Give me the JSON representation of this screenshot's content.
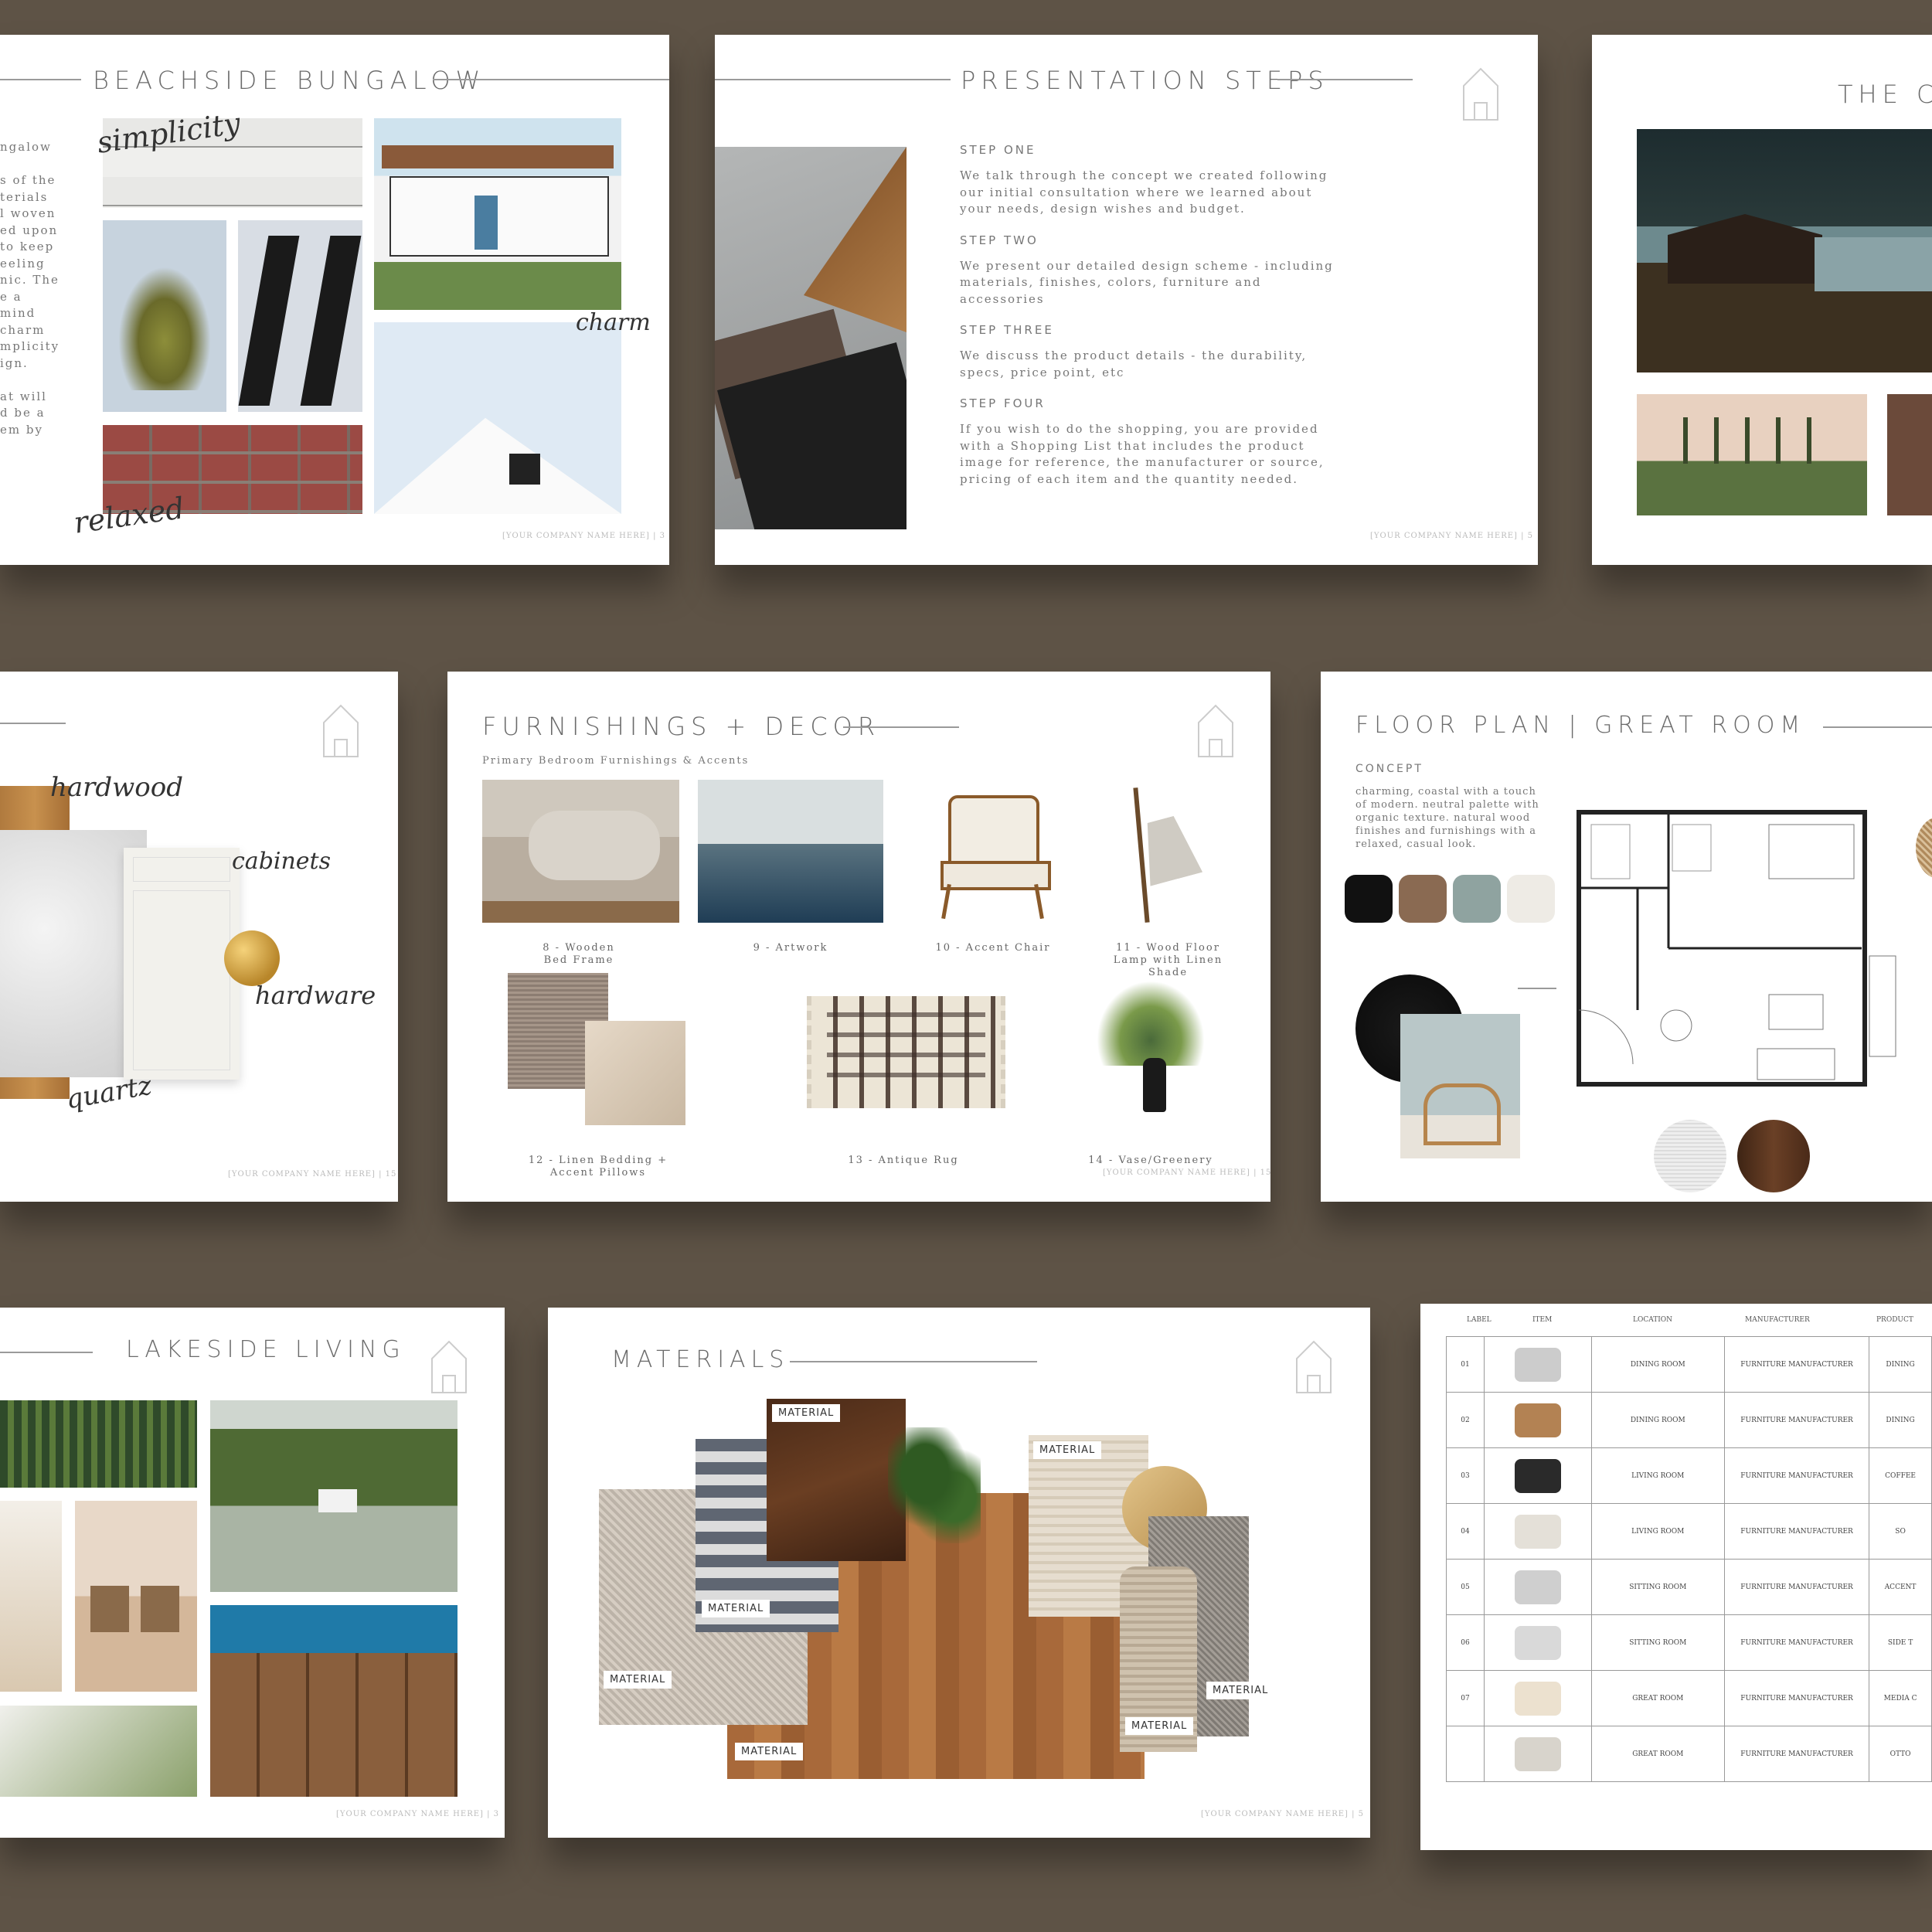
{
  "slides": {
    "beachside": {
      "title": "BEACHSIDE BUNGALOW",
      "body": [
        "ngalow",
        "",
        "s of the",
        "terials",
        "l woven",
        "ed upon",
        "to keep",
        "eeling",
        "nic. The",
        "e a",
        "mind",
        "charm",
        "mplicity",
        "ign.",
        "",
        "at will",
        "d be a",
        "em by"
      ],
      "words": [
        "simplicity",
        "charm",
        "relaxed"
      ],
      "footer": "[YOUR COMPANY NAME HERE] | 3"
    },
    "steps": {
      "title": "PRESENTATION STEPS",
      "items": [
        {
          "head": "STEP ONE",
          "text": "We talk through the concept we created following our initial consultation where we learned about your needs, design wishes and budget."
        },
        {
          "head": "STEP TWO",
          "text": "We present our detailed design scheme - including materials, finishes, colors, furniture and accessories"
        },
        {
          "head": "STEP THREE",
          "text": "We discuss the product details - the durability, specs, price point, etc"
        },
        {
          "head": "STEP FOUR",
          "text": "If you wish to do the shopping, you are provided with a Shopping List that includes the product image for reference, the manufacturer or source, pricing of each item and the quantity needed."
        }
      ],
      "footer": "[YOUR COMPANY NAME HERE] | 5"
    },
    "thecl": {
      "title": "THE CL"
    },
    "kitchen": {
      "words": [
        "hardwood",
        "cabinets",
        "hardware",
        "quartz"
      ],
      "footer": "[YOUR COMPANY NAME HERE] | 15"
    },
    "furnishings": {
      "title": "FURNISHINGS + DECOR",
      "subtitle": "Primary Bedroom Furnishings & Accents",
      "captions": [
        "8 - Wooden Bed Frame",
        "9 - Artwork",
        "10 - Accent Chair",
        "11 - Wood Floor Lamp with Linen Shade",
        "12 - Linen Bedding + Accent Pillows",
        "13 - Antique Rug",
        "14 - Vase/Greenery"
      ],
      "footer": "[YOUR COMPANY NAME HERE] | 15"
    },
    "floorplan": {
      "title": "FLOOR PLAN | GREAT ROOM",
      "concept_label": "CONCEPT",
      "concept_text": "charming, coastal with a touch of modern. neutral palette with organic texture. natural wood finishes and furnishings with a relaxed, casual look.",
      "swatches": [
        "#111111",
        "#8a6a52",
        "#8fa3a0",
        "#eeebe5"
      ]
    },
    "lakeside": {
      "title": "LAKESIDE LIVING",
      "footer": "[YOUR COMPANY NAME HERE] | 3"
    },
    "materials": {
      "title": "MATERIALS",
      "tag": "MATERIAL",
      "footer": "[YOUR COMPANY NAME HERE] | 5"
    },
    "schedule": {
      "headers": [
        "LABEL",
        "ITEM",
        "LOCATION",
        "MANUFACTURER",
        "PRODUCT"
      ],
      "rows": [
        [
          "01",
          "DINING ROOM",
          "FURNITURE MANUFACTURER",
          "DINING"
        ],
        [
          "02",
          "DINING ROOM",
          "FURNITURE MANUFACTURER",
          "DINING"
        ],
        [
          "03",
          "LIVING ROOM",
          "FURNITURE MANUFACTURER",
          "COFFEE"
        ],
        [
          "04",
          "LIVING ROOM",
          "FURNITURE MANUFACTURER",
          "SO"
        ],
        [
          "05",
          "SITTING ROOM",
          "FURNITURE MANUFACTURER",
          "ACCENT"
        ],
        [
          "06",
          "SITTING ROOM",
          "FURNITURE MANUFACTURER",
          "SIDE T"
        ],
        [
          "07",
          "GREAT ROOM",
          "FURNITURE MANUFACTURER",
          "MEDIA C"
        ],
        [
          "",
          "GREAT ROOM",
          "FURNITURE MANUFACTURER",
          "OTTO"
        ]
      ]
    }
  }
}
